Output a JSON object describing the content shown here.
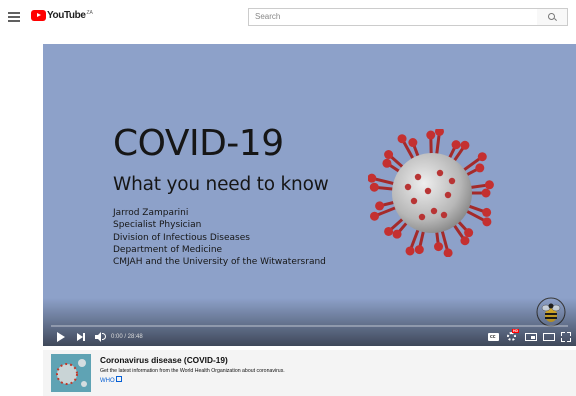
{
  "header": {
    "logo_text": "YouTube",
    "logo_country": "ZA",
    "search_placeholder": "Search"
  },
  "video": {
    "slide": {
      "title": "COVID-19",
      "subtitle": "What you need to know",
      "lines": [
        "Jarrod Zamparini",
        "Specialist Physician",
        "Division of Infectious Diseases",
        "Department of Medicine",
        "CMJAH and the University of the Witwatersrand"
      ]
    },
    "time": "0:00 / 28:48",
    "progress": 0
  },
  "info_panel": {
    "title": "Coronavirus disease (COVID-19)",
    "description": "Get the latest information from the World Health Organization about coronavirus.",
    "link": "WHO"
  },
  "icons": {
    "menu": "hamburger-icon",
    "search": "search-icon",
    "play": "play-icon",
    "next": "next-icon",
    "volume": "volume-icon",
    "captions": "captions-icon",
    "settings": "settings-icon",
    "miniplayer": "miniplayer-icon",
    "theater": "theater-mode-icon",
    "fullscreen": "fullscreen-icon",
    "external": "external-link-icon"
  },
  "colors": {
    "brand": "#ff0000",
    "slide_background": "#8da1c9",
    "info_background": "#f4f4f4",
    "link": "#065fd4"
  }
}
